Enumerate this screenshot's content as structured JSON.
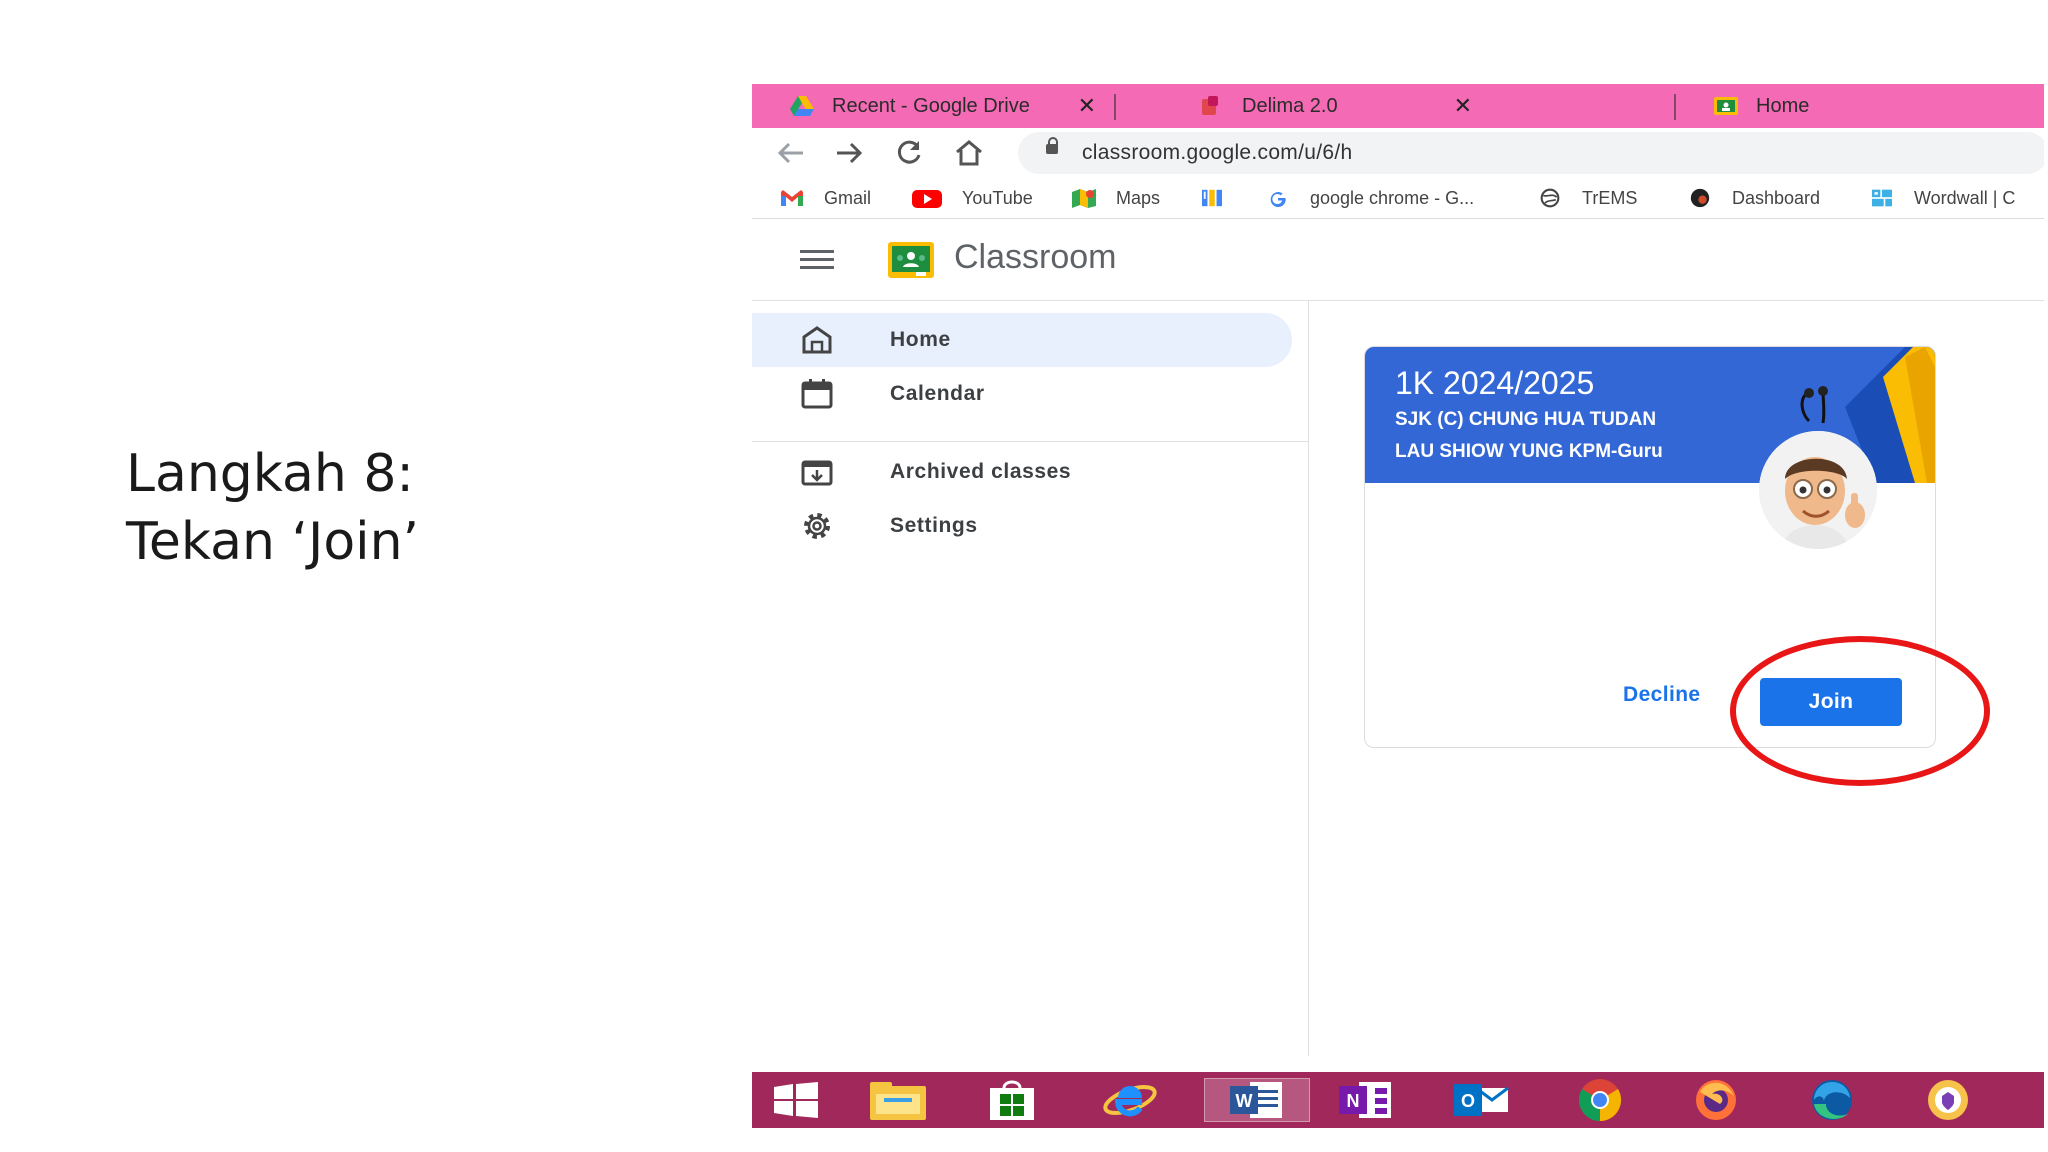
{
  "caption": {
    "line1": "Langkah 8:",
    "line2": "Tekan ‘Join’"
  },
  "browser": {
    "tabs": [
      {
        "label": "Recent - Google Drive",
        "icon": "google-drive-icon"
      },
      {
        "label": "Delima 2.0",
        "icon": "delima-icon"
      },
      {
        "label": "Home",
        "icon": "classroom-icon"
      }
    ],
    "close_glyph": "✕",
    "url": "classroom.google.com/u/6/h",
    "bookmarks": [
      {
        "label": "Gmail",
        "icon": "gmail-icon"
      },
      {
        "label": "YouTube",
        "icon": "youtube-icon"
      },
      {
        "label": "Maps",
        "icon": "maps-icon"
      },
      {
        "label": "",
        "icon": "bookmark-book-icon"
      },
      {
        "label": "google chrome - G...",
        "icon": "google-icon"
      },
      {
        "label": "TrEMS",
        "icon": "globe-icon"
      },
      {
        "label": "Dashboard",
        "icon": "dashboard-icon"
      },
      {
        "label": "Wordwall | C",
        "icon": "wordwall-icon"
      }
    ]
  },
  "app": {
    "title": "Classroom",
    "nav": {
      "home": "Home",
      "calendar": "Calendar",
      "archived": "Archived classes",
      "settings": "Settings"
    },
    "invite_card": {
      "title": "1K 2024/2025",
      "school": "SJK (C) CHUNG HUA TUDAN",
      "teacher": "LAU SHIOW YUNG KPM-Guru",
      "decline_label": "Decline",
      "join_label": "Join"
    }
  },
  "taskbar": {
    "apps": [
      "windows-start-icon",
      "file-explorer-icon",
      "microsoft-store-icon",
      "internet-explorer-icon",
      "word-icon",
      "onenote-icon",
      "outlook-icon",
      "chrome-icon",
      "firefox-icon",
      "edge-icon",
      "vpn-icon"
    ],
    "active": "word-icon"
  },
  "colors": {
    "tab_bar": "#f46ab4",
    "card_header": "#3367d6",
    "join_button": "#1a73e8",
    "annotation": "#e81616",
    "taskbar": "#a0285a"
  }
}
